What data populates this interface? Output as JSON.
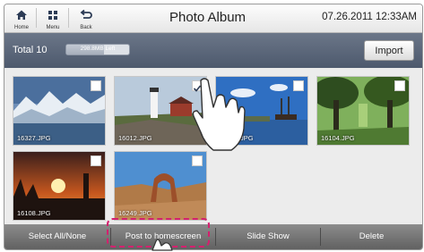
{
  "header": {
    "home_label": "Home",
    "menu_label": "Menu",
    "back_label": "Back",
    "title": "Photo Album",
    "datetime": "07.26.2011 12:33AM"
  },
  "infobar": {
    "total_label": "Total 10",
    "storage_text": "298.8MB Left",
    "import_label": "Import"
  },
  "photos": [
    {
      "filename": "16327.JPG",
      "scene": "glacier-mountains",
      "checked": false
    },
    {
      "filename": "16012.JPG",
      "scene": "lighthouse",
      "checked": true
    },
    {
      "filename": "16104.JPG",
      "scene": "harbor-ship",
      "checked": false
    },
    {
      "filename": "16104.JPG",
      "scene": "oak-trees",
      "checked": false
    },
    {
      "filename": "16108.JPG",
      "scene": "sunset-silhouette",
      "checked": false
    },
    {
      "filename": "16249.JPG",
      "scene": "desert-arch",
      "checked": false
    }
  ],
  "footer": {
    "select_all_label": "Select All/None",
    "post_label": "Post to homescreen",
    "slideshow_label": "Slide Show",
    "delete_label": "Delete"
  },
  "colors": {
    "highlight": "#d4206e",
    "infobar": "#5a6579",
    "bottombar": "#6f6f6f"
  }
}
